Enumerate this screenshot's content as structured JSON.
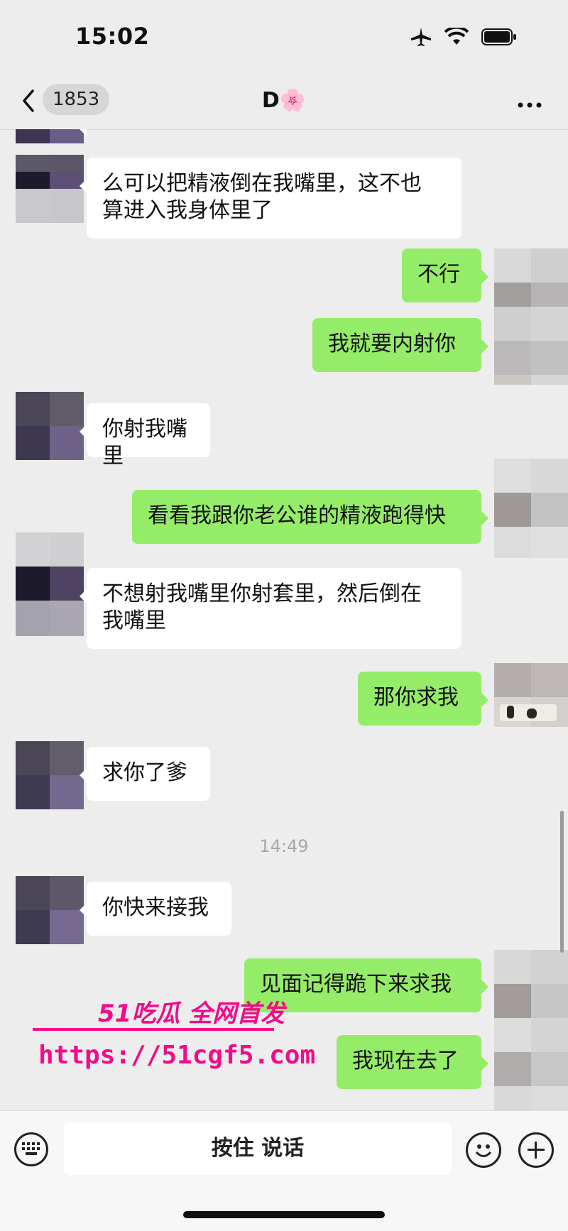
{
  "status": {
    "time": "15:02"
  },
  "nav": {
    "unread": "1853",
    "title": "D🌸"
  },
  "messages": [
    {
      "side": "left",
      "text": "么可以把精液倒在我嘴里，这不也\n算进入我身体里了"
    },
    {
      "side": "right",
      "text": "不行"
    },
    {
      "side": "right",
      "text": "我就要内射你"
    },
    {
      "side": "left",
      "text": "你射我嘴里"
    },
    {
      "side": "right",
      "text": "看看我跟你老公谁的精液跑得快"
    },
    {
      "side": "left",
      "text": "不想射我嘴里你射套里，然后倒在\n我嘴里"
    },
    {
      "side": "right",
      "text": "那你求我"
    },
    {
      "side": "left",
      "text": "求你了爹"
    },
    {
      "side": "left",
      "text": "你快来接我"
    },
    {
      "side": "right",
      "text": "见面记得跪下来求我"
    },
    {
      "side": "right",
      "text": "我现在去了"
    }
  ],
  "timestamp": "14:49",
  "watermark": {
    "brand": "51吃瓜 全网首发",
    "url": "https://51cgf5.com"
  },
  "input": {
    "hold_to_talk": "按住 说话"
  },
  "colors": {
    "sent_bubble": "#95ec69",
    "received_bubble": "#ffffff",
    "background": "#ededed",
    "watermark": "#f40a8a"
  }
}
